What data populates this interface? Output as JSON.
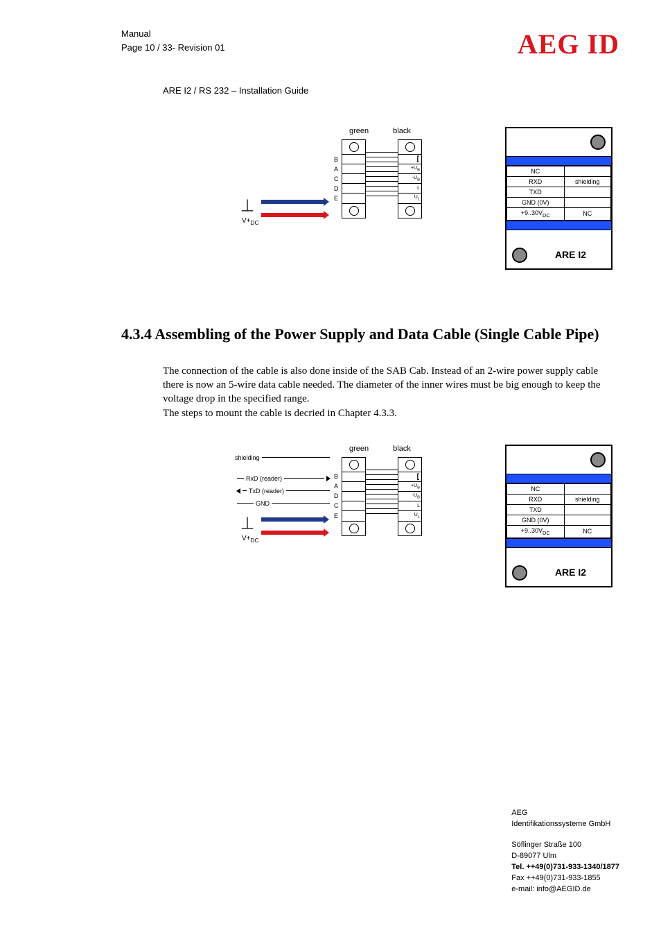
{
  "header": {
    "manual": "Manual",
    "page_line": "Page 10 / 33- Revision 01",
    "logo": "AEG ID"
  },
  "subtitle": "ARE I2 / RS 232 – Installation Guide",
  "fig1": {
    "green": "green",
    "black": "black",
    "vplus": "V+",
    "dc": "DC",
    "pins_left": [
      "B",
      "A",
      "C",
      "D",
      "E"
    ],
    "pins_right_labels": [
      "",
      "+U",
      "-U",
      "L",
      "U"
    ],
    "sub_b": "B",
    "sub_l": "L"
  },
  "are_box": {
    "rows_left": [
      "NC",
      "RXD",
      "TXD",
      "GND (0V)",
      "+9..30V"
    ],
    "rows_left_sub": "DC",
    "rows_right": [
      "",
      "shielding",
      "",
      "",
      "NC"
    ],
    "label": "ARE I2"
  },
  "section": {
    "heading": "4.3.4  Assembling of the Power Supply and Data Cable (Single Cable Pipe)",
    "para": "The connection of the cable is also done inside of the SAB Cab. Instead of an 2-wire power supply cable there is now an 5-wire data cable needed. The diameter of the inner wires must be big enough to keep the voltage drop in the specified range.\nThe steps to mount the cable is decried in Chapter 4.3.3."
  },
  "fig2": {
    "shielding": "shielding",
    "rxd": "RxD (reader)",
    "txd": "TxD (reader)",
    "gnd": "GND",
    "pins_left": [
      "B",
      "A",
      "D",
      "C",
      "E"
    ]
  },
  "footer": {
    "company1": "AEG",
    "company2": "Identifikationssysteme GmbH",
    "addr1": "Söflinger Straße 100",
    "addr2": "D-89077 Ulm",
    "tel": "Tel.   ++49(0)731-933-1340/1877",
    "fax": "Fax  ++49(0)731-933-1855",
    "email": "e-mail: info@AEGID.de"
  }
}
